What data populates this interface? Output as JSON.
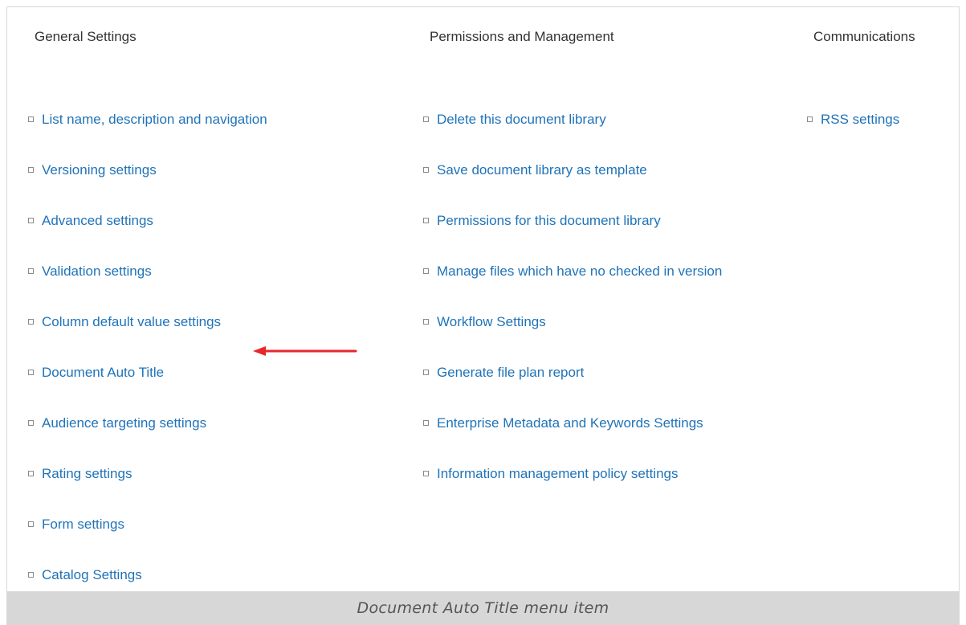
{
  "columns": [
    {
      "heading": "General Settings",
      "items": [
        "List name, description and navigation",
        "Versioning settings",
        "Advanced settings",
        "Validation settings",
        "Column default value settings",
        "Document Auto Title",
        "Audience targeting settings",
        "Rating settings",
        "Form settings",
        "Catalog Settings"
      ]
    },
    {
      "heading": "Permissions and Management",
      "items": [
        "Delete this document library",
        "Save document library as template",
        "Permissions for this document library",
        "Manage files which have no checked in version",
        "Workflow Settings",
        "Generate file plan report",
        "Enterprise Metadata and Keywords Settings",
        "Information management policy settings"
      ]
    },
    {
      "heading": "Communications",
      "items": [
        "RSS settings"
      ]
    }
  ],
  "annotation": {
    "arrow_color": "#e8262c",
    "points_to": "Document Auto Title"
  },
  "caption": "Document Auto Title menu item",
  "colors": {
    "link": "#1f73b8",
    "heading": "#333333",
    "caption_bar": "#d7d7d7"
  }
}
